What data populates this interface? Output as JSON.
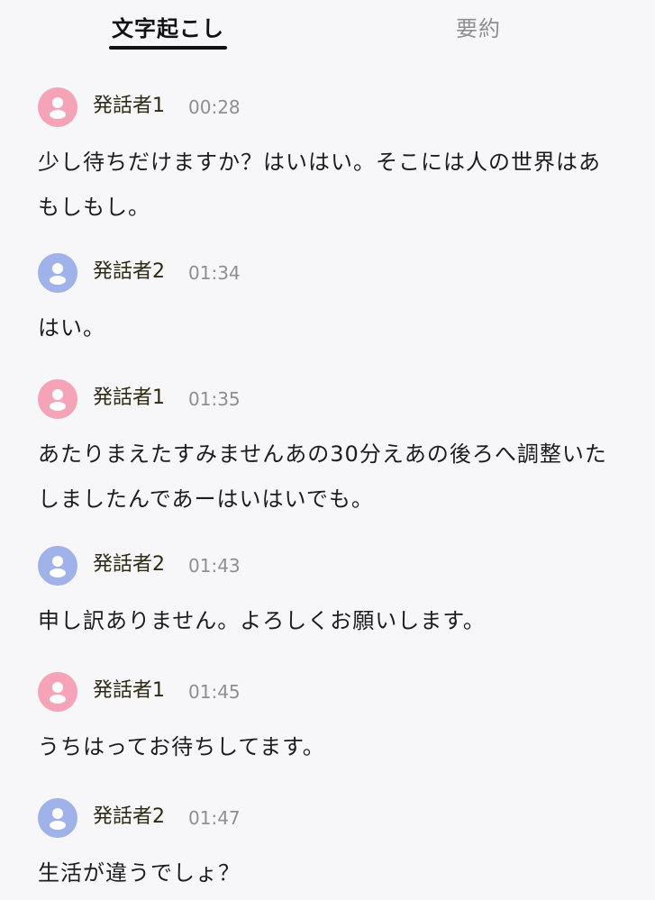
{
  "tabs": {
    "transcript_label": "文字起こし",
    "summary_label": "要約"
  },
  "colors": {
    "background": "#f7f6f9",
    "speaker1_avatar": "#f5a3b7",
    "speaker2_avatar": "#9fb2ea",
    "text": "#1d1d1f",
    "muted": "#8e8e93"
  },
  "icons": {
    "avatar": "person-icon"
  },
  "transcript": [
    {
      "speaker": "発話者1",
      "time": "00:28",
      "text": "少し待ちだけますか？はいはい。そこには人の世界はあもしもし。"
    },
    {
      "speaker": "発話者2",
      "time": "01:34",
      "text": "はい。"
    },
    {
      "speaker": "発話者1",
      "time": "01:35",
      "text": "あたりまえたすみませんあの30分えあの後ろへ調整いたしましたんであーはいはいでも。"
    },
    {
      "speaker": "発話者2",
      "time": "01:43",
      "text": "申し訳ありません。よろしくお願いします。"
    },
    {
      "speaker": "発話者1",
      "time": "01:45",
      "text": "うちはってお待ちしてます。"
    },
    {
      "speaker": "発話者2",
      "time": "01:47",
      "text": "生活が違うでしょ？"
    }
  ]
}
